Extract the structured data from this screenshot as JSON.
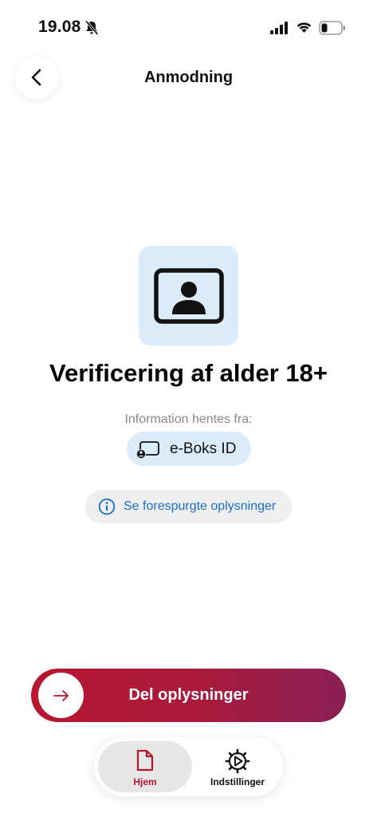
{
  "status_bar": {
    "time": "19.08"
  },
  "header": {
    "title": "Anmodning"
  },
  "request": {
    "heading": "Verificering af alder 18+",
    "source_label": "Information hentes fra:",
    "source_name": "e-Boks ID",
    "details_label": "Se forespurgte oplysninger"
  },
  "share": {
    "label": "Del oplysninger"
  },
  "nav": {
    "items": [
      {
        "label": "Hjem"
      },
      {
        "label": "Indstillinger"
      }
    ]
  },
  "colors": {
    "accent": "#b3172e",
    "tile_bg": "#dcecfb",
    "link": "#1a6fd1"
  }
}
